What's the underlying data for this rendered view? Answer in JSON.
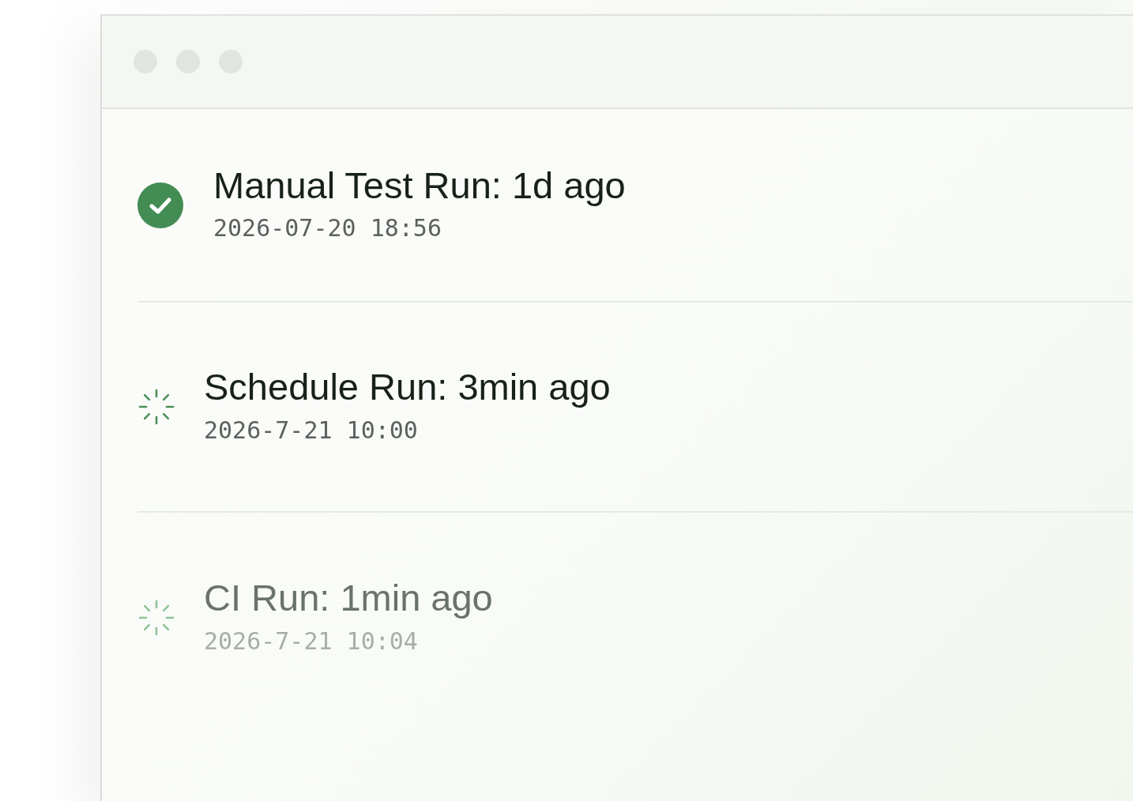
{
  "runs": [
    {
      "title": "Manual Test Run: 1d ago",
      "timestamp": "2026-07-20 18:56",
      "kind": "done"
    },
    {
      "title": "Schedule Run: 3min ago",
      "timestamp": "2026-7-21 10:00",
      "kind": "running"
    },
    {
      "title": "CI Run: 1min ago",
      "timestamp": "2026-7-21 10:04",
      "kind": "queued"
    }
  ]
}
